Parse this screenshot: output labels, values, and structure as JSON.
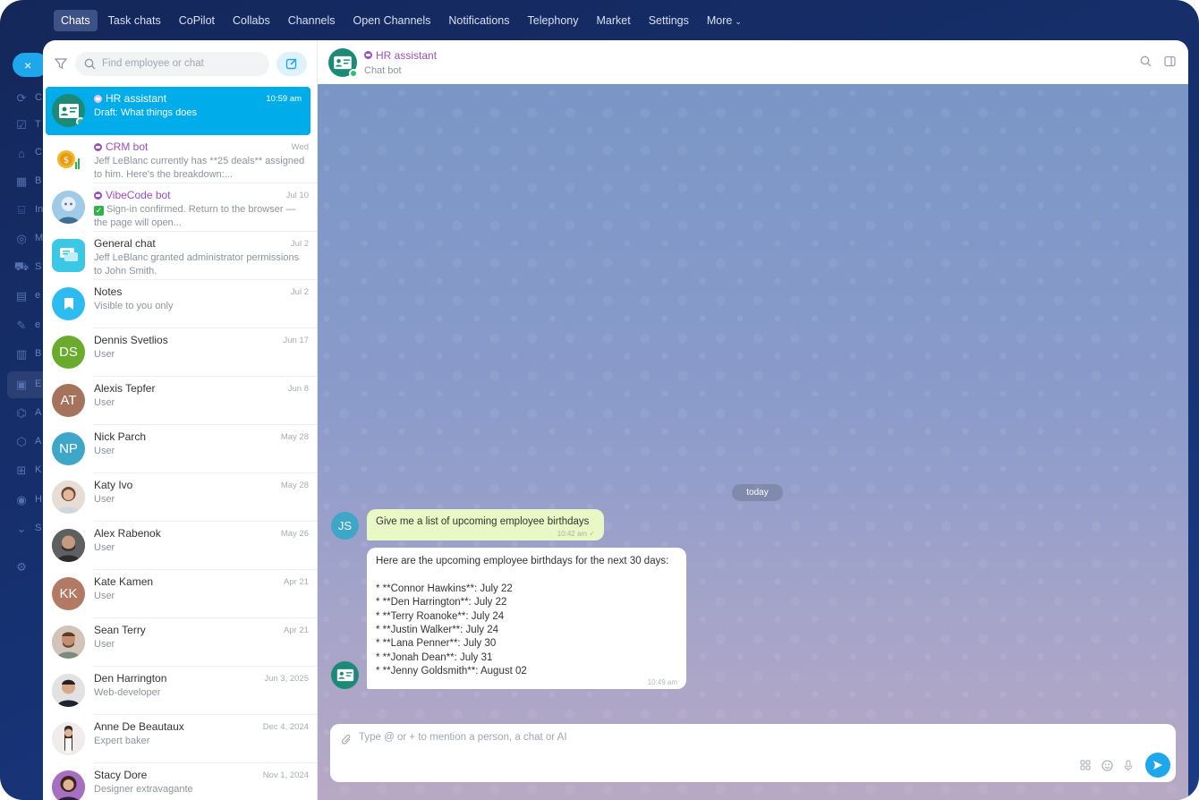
{
  "topnav": {
    "items": [
      "Chats",
      "Task chats",
      "CoPilot",
      "Collabs",
      "Channels",
      "Open Channels",
      "Notifications",
      "Telephony",
      "Market",
      "Settings",
      "More"
    ]
  },
  "rail": {
    "close": "×",
    "letters": [
      "C",
      "T",
      "C",
      "B",
      "In",
      "M",
      "S",
      "e",
      "e",
      "B",
      "E",
      "A",
      "A",
      "K",
      "H",
      "S"
    ],
    "badge": "1"
  },
  "chatlist": {
    "search_placeholder": "Find employee or chat",
    "rows": [
      {
        "title": "HR assistant",
        "time": "10:59 am",
        "sub": "Draft: What things does",
        "bot": true,
        "initials": ""
      },
      {
        "title": "CRM bot",
        "time": "Wed",
        "sub": "Jeff LeBlanc currently has **25 deals** assigned to him. Here's the breakdown:...",
        "bot": true,
        "initials": ""
      },
      {
        "title": "VibeCode bot",
        "time": "Jul 10",
        "sub": "Sign-in confirmed. Return to the browser — the page will open...",
        "bot": true,
        "initials": ""
      },
      {
        "title": "General chat",
        "time": "Jul 2",
        "sub": "Jeff LeBlanc granted administrator permissions to John Smith.",
        "bot": false,
        "initials": ""
      },
      {
        "title": "Notes",
        "time": "Jul 2",
        "sub": "Visible to you only",
        "bot": false,
        "initials": ""
      },
      {
        "title": "Dennis Svetlios",
        "time": "Jun 17",
        "sub": "User",
        "bot": false,
        "initials": "DS"
      },
      {
        "title": "Alexis Tepfer",
        "time": "Jun 8",
        "sub": "User",
        "bot": false,
        "initials": "AT"
      },
      {
        "title": "Nick Parch",
        "time": "May 28",
        "sub": "User",
        "bot": false,
        "initials": "NP"
      },
      {
        "title": "Katy Ivo",
        "time": "May 28",
        "sub": "User",
        "bot": false,
        "initials": ""
      },
      {
        "title": "Alex Rabenok",
        "time": "May 26",
        "sub": "User",
        "bot": false,
        "initials": ""
      },
      {
        "title": "Kate Kamen",
        "time": "Apr 21",
        "sub": "User",
        "bot": false,
        "initials": "KK"
      },
      {
        "title": "Sean Terry",
        "time": "Apr 21",
        "sub": "User",
        "bot": false,
        "initials": ""
      },
      {
        "title": "Den Harrington",
        "time": "Jun 3, 2025",
        "sub": "Web-developer",
        "bot": false,
        "initials": ""
      },
      {
        "title": "Anne De Beautaux",
        "time": "Dec 4, 2024",
        "sub": "Expert baker",
        "bot": false,
        "initials": ""
      },
      {
        "title": "Stacy Dore",
        "time": "Nov 1, 2024",
        "sub": "Designer extravagante",
        "bot": false,
        "initials": ""
      }
    ]
  },
  "chat": {
    "title": "HR assistant",
    "subtitle": "Chat bot",
    "date_divider": "today",
    "user_initials": "JS",
    "outgoing": {
      "text": "Give me a list of upcoming employee birthdays",
      "time": "10:42 am"
    },
    "incoming": {
      "text": "Here are the upcoming employee birthdays for the next 30 days:\n\n* **Connor Hawkins**: July 22\n* **Den Harrington**: July 22\n* **Terry Roanoke**: July 24\n* **Justin Walker**: July 24\n* **Lana Penner**: July 30\n* **Jonah Dean**: July 31\n* **Jenny Goldsmith**: August 02",
      "time": "10:49 am"
    },
    "composer_placeholder": "Type @ or + to mention a person, a chat or AI"
  },
  "colors": {
    "accent": "#1fa7ec",
    "active_row": "#00acea",
    "bot_purple": "#9b4fbf",
    "outgoing_bubble": "#e8f9c6"
  },
  "avatar_colors": {
    "DS": "#6aab2e",
    "AT": "#a5725c",
    "NP": "#3ea6c7",
    "KK": "#b27a64"
  }
}
